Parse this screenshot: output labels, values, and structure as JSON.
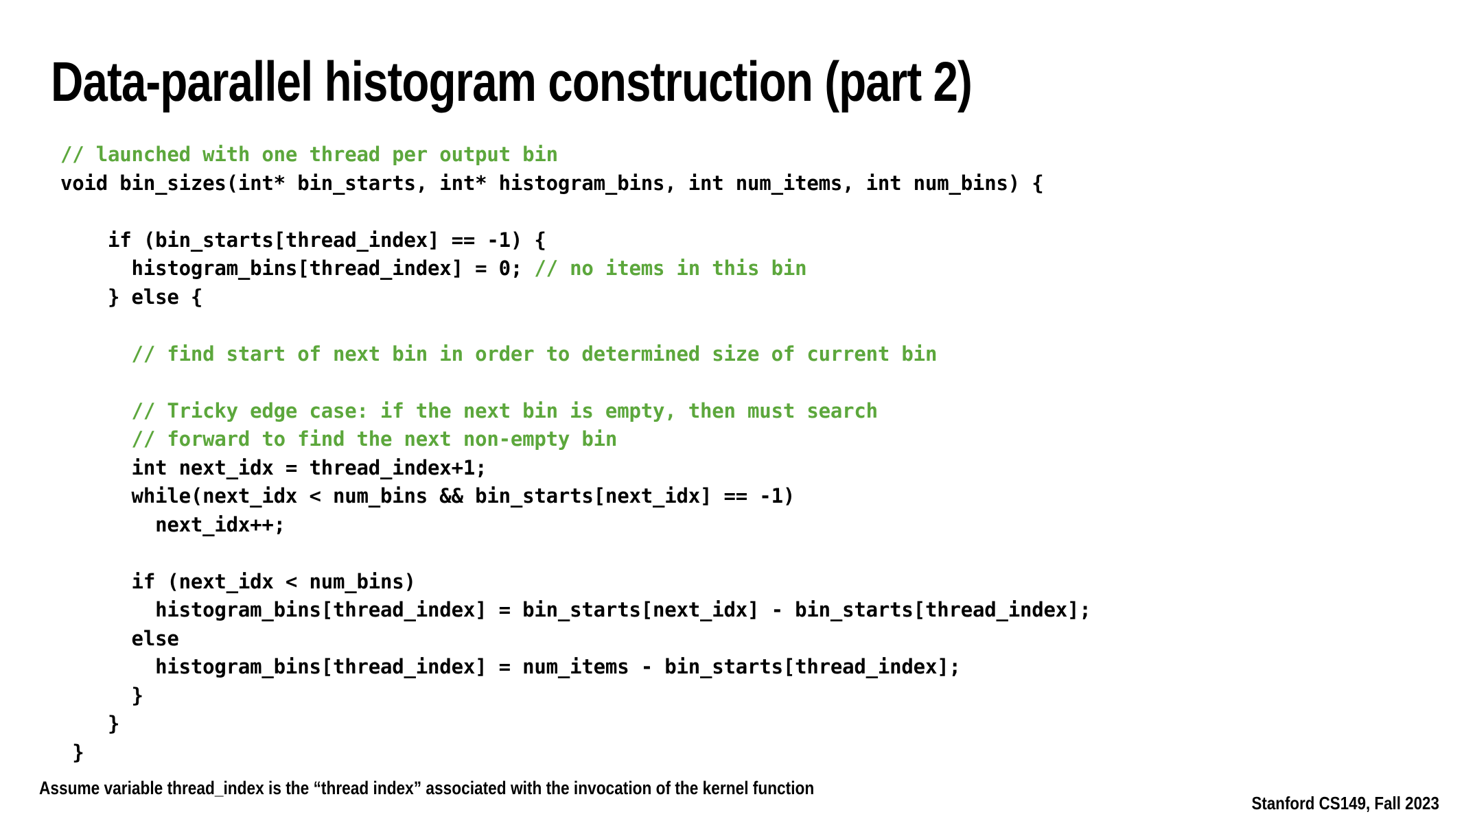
{
  "slide": {
    "title": "Data-parallel histogram construction (part 2)",
    "background_color": "#ffffff",
    "text_color": "#000000",
    "comment_color": "#5CA73C",
    "footer_note": "Assume variable thread_index is the “thread index” associated with the invocation of the kernel function",
    "attribution": "Stanford CS149, Fall 2023"
  },
  "code": {
    "language": "c",
    "lines": [
      {
        "indent": 0,
        "text": "// launched with one thread per output bin",
        "kind": "comment"
      },
      {
        "indent": 0,
        "text": "void bin_sizes(int* bin_starts, int* histogram_bins, int num_items, int num_bins) {",
        "kind": "code"
      },
      {
        "indent": 0,
        "text": "",
        "kind": "blank"
      },
      {
        "indent": 4,
        "text": "if (bin_starts[thread_index] == -1) {",
        "kind": "code"
      },
      {
        "indent": 6,
        "text": "histogram_bins[thread_index] = 0;",
        "kind": "code",
        "trailing_comment": "// no items in this bin",
        "comment_col": 34
      },
      {
        "indent": 4,
        "text": "} else {",
        "kind": "code"
      },
      {
        "indent": 0,
        "text": "",
        "kind": "blank"
      },
      {
        "indent": 6,
        "text": "// find start of next bin in order to determined size of current bin",
        "kind": "comment"
      },
      {
        "indent": 0,
        "text": "",
        "kind": "blank"
      },
      {
        "indent": 6,
        "text": "// Tricky edge case: if the next bin is empty, then must search",
        "kind": "comment"
      },
      {
        "indent": 6,
        "text": "// forward to find the next non-empty bin",
        "kind": "comment"
      },
      {
        "indent": 6,
        "text": "int next_idx = thread_index+1;",
        "kind": "code"
      },
      {
        "indent": 6,
        "text": "while(next_idx < num_bins && bin_starts[next_idx] == -1)",
        "kind": "code"
      },
      {
        "indent": 8,
        "text": "next_idx++;",
        "kind": "code"
      },
      {
        "indent": 0,
        "text": "",
        "kind": "blank"
      },
      {
        "indent": 6,
        "text": "if (next_idx < num_bins)",
        "kind": "code"
      },
      {
        "indent": 8,
        "text": "histogram_bins[thread_index] = bin_starts[next_idx] - bin_starts[thread_index];",
        "kind": "code"
      },
      {
        "indent": 6,
        "text": "else",
        "kind": "code"
      },
      {
        "indent": 8,
        "text": "histogram_bins[thread_index] = num_items - bin_starts[thread_index];",
        "kind": "code"
      },
      {
        "indent": 6,
        "text": "}",
        "kind": "code"
      },
      {
        "indent": 4,
        "text": "}",
        "kind": "code"
      },
      {
        "indent": 1,
        "text": "}",
        "kind": "code"
      }
    ]
  }
}
